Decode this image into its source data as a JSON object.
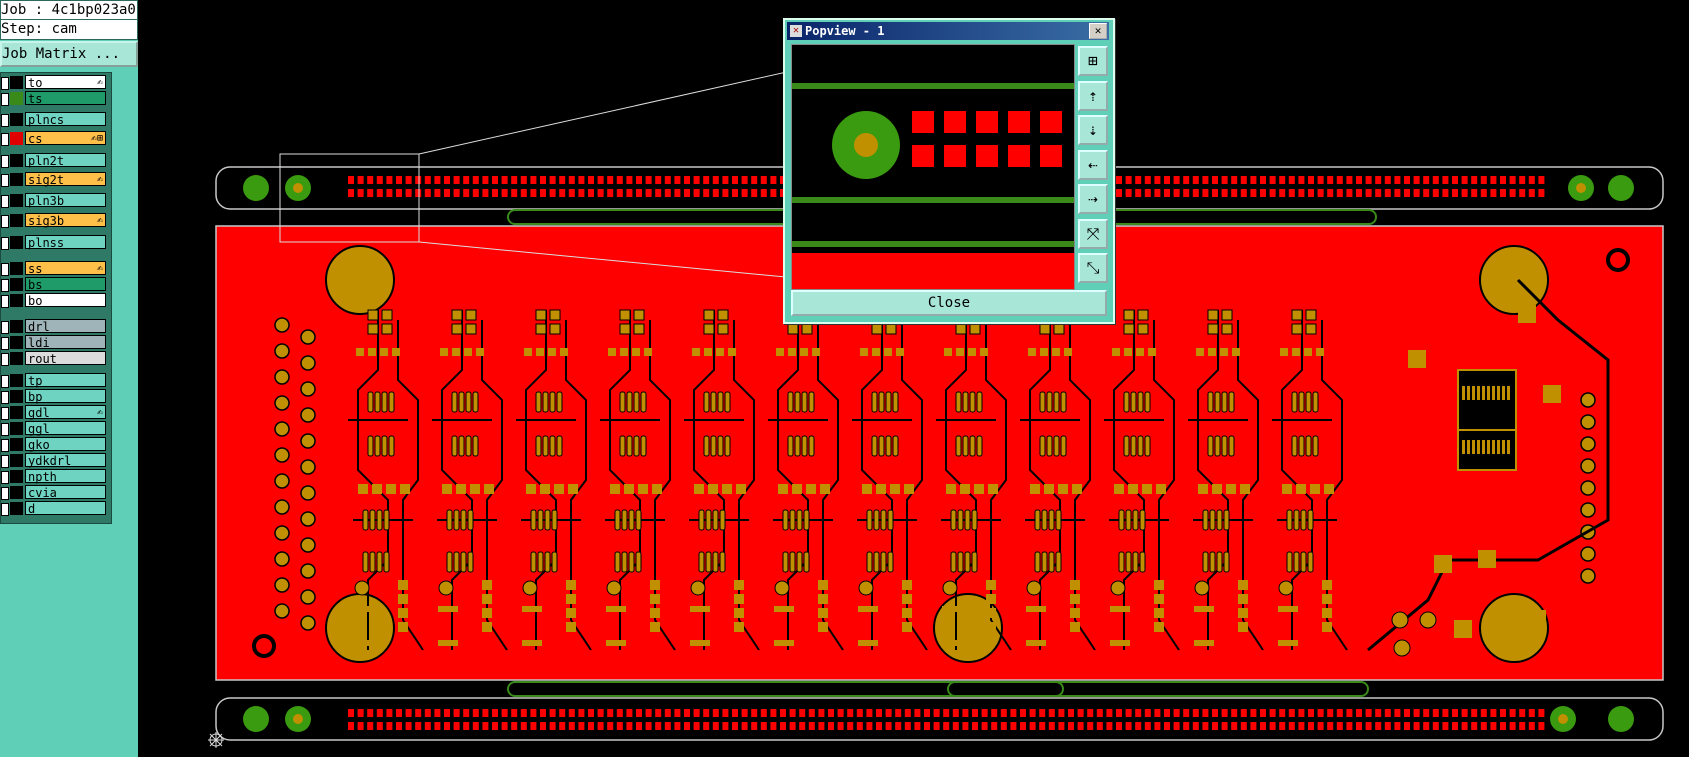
{
  "job": {
    "job_label": "Job : 4c1bp023a0",
    "step_label": "Step: cam",
    "matrix_button": "Job Matrix ..."
  },
  "layers": [
    {
      "name": "to",
      "color": "#ffffff",
      "swatch": "#000000",
      "icon": "✍"
    },
    {
      "name": "ts",
      "color": "#1f9b6a",
      "swatch": "#3a8a1a",
      "icon": ""
    },
    {
      "name": "plncs",
      "color": "#6ed3c0",
      "swatch": "#000000",
      "icon": ""
    },
    {
      "name": "cs",
      "color": "#ffc04a",
      "swatch": "#e00000",
      "icon": "✍⊞"
    },
    {
      "name": "pln2t",
      "color": "#6ed3c0",
      "swatch": "#000000",
      "icon": ""
    },
    {
      "name": "sig2t",
      "color": "#ffc04a",
      "swatch": "#000000",
      "icon": "✍"
    },
    {
      "name": "pln3b",
      "color": "#6ed3c0",
      "swatch": "#000000",
      "icon": ""
    },
    {
      "name": "sig3b",
      "color": "#ffc04a",
      "swatch": "#000000",
      "icon": "✍"
    },
    {
      "name": "plnss",
      "color": "#6ed3c0",
      "swatch": "#000000",
      "icon": ""
    },
    {
      "name": "ss",
      "color": "#ffc04a",
      "swatch": "#000000",
      "icon": "✍"
    },
    {
      "name": "bs",
      "color": "#1f9b6a",
      "swatch": "#000000",
      "icon": ""
    },
    {
      "name": "bo",
      "color": "#ffffff",
      "swatch": "#000000",
      "icon": ""
    },
    {
      "name": "drl",
      "color": "#9fb4b8",
      "swatch": "#000000",
      "icon": ""
    },
    {
      "name": "ldi",
      "color": "#9fb4b8",
      "swatch": "#000000",
      "icon": ""
    },
    {
      "name": "rout",
      "color": "#dcdcdc",
      "swatch": "#000000",
      "icon": ""
    },
    {
      "name": "tp",
      "color": "#6ed3c0",
      "swatch": "#000000",
      "icon": ""
    },
    {
      "name": "bp",
      "color": "#6ed3c0",
      "swatch": "#000000",
      "icon": ""
    },
    {
      "name": "gdl",
      "color": "#6ed3c0",
      "swatch": "#000000",
      "icon": "✍"
    },
    {
      "name": "ggl",
      "color": "#6ed3c0",
      "swatch": "#000000",
      "icon": ""
    },
    {
      "name": "gko",
      "color": "#6ed3c0",
      "swatch": "#000000",
      "icon": ""
    },
    {
      "name": "ydkdrl",
      "color": "#6ed3c0",
      "swatch": "#000000",
      "icon": ""
    },
    {
      "name": "npth",
      "color": "#6ed3c0",
      "swatch": "#000000",
      "icon": ""
    },
    {
      "name": "cvia",
      "color": "#6ed3c0",
      "swatch": "#000000",
      "icon": ""
    },
    {
      "name": "d",
      "color": "#6ed3c0",
      "swatch": "#000000",
      "icon": ""
    }
  ],
  "popup": {
    "title": "Popview - 1",
    "close_x": "✕",
    "close_button": "Close",
    "tools": [
      "fit-icon",
      "pan-up-icon",
      "pan-down-icon",
      "pan-left-icon",
      "pan-right-icon",
      "zoom-in-icon",
      "zoom-out-icon"
    ]
  },
  "colors": {
    "copper": "#ff0000",
    "pad": "#c09000",
    "mask": "#3a8a1a",
    "outline": "#c8c8c8",
    "panel": "#5fcfb8"
  }
}
